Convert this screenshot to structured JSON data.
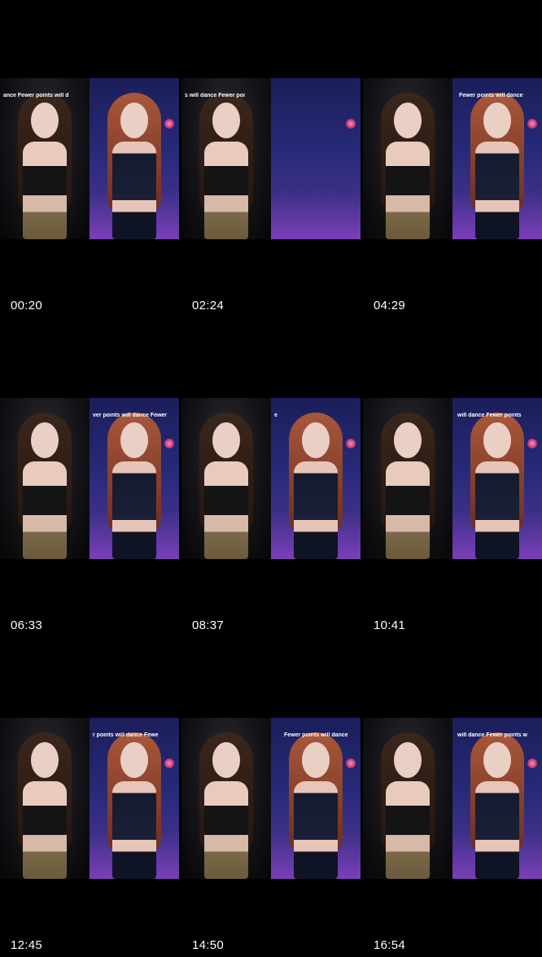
{
  "thumbnails": [
    {
      "timestamp": "00:20",
      "caption": "ance     Fewer points will d"
    },
    {
      "timestamp": "02:24",
      "caption": "s will dance     Fewer poi"
    },
    {
      "timestamp": "04:29",
      "caption": "Fewer points will dance"
    },
    {
      "timestamp": "06:33",
      "caption": "ver points will dance     Fewer"
    },
    {
      "timestamp": "08:37",
      "caption": "e"
    },
    {
      "timestamp": "10:41",
      "caption": "will dance     Fewer points"
    },
    {
      "timestamp": "12:45",
      "caption": "r points will dance     Fewe"
    },
    {
      "timestamp": "14:50",
      "caption": "Fewer points will dance"
    },
    {
      "timestamp": "16:54",
      "caption": "will dance     Fewer points w"
    }
  ],
  "colors": {
    "background": "#000000",
    "timestamp_text": "#ffffff"
  }
}
